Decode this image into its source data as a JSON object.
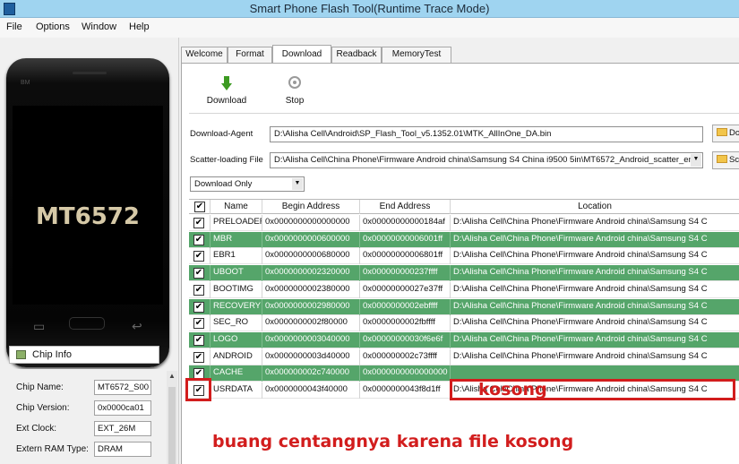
{
  "window": {
    "title": "Smart Phone Flash Tool(Runtime Trace Mode)"
  },
  "menu": [
    "File",
    "Options",
    "Window",
    "Help"
  ],
  "phone": {
    "brand": "BM",
    "model": "MT6572"
  },
  "chip_info": {
    "tab_label": "Chip Info",
    "rows": [
      {
        "key": "Chip Name:",
        "value": "MT6572_S00"
      },
      {
        "key": "Chip Version:",
        "value": "0x0000ca01"
      },
      {
        "key": "Ext Clock:",
        "value": "EXT_26M"
      },
      {
        "key": "Extern RAM Type:",
        "value": "DRAM"
      }
    ]
  },
  "tabs": [
    {
      "label": "Welcome",
      "active": false
    },
    {
      "label": "Format",
      "active": false
    },
    {
      "label": "Download",
      "active": true
    },
    {
      "label": "Readback",
      "active": false
    },
    {
      "label": "MemoryTest",
      "active": false
    }
  ],
  "toolbar": {
    "download_label": "Download",
    "stop_label": "Stop"
  },
  "download_agent": {
    "label": "Download-Agent",
    "value": "D:\\Alisha Cell\\Android\\SP_Flash_Tool_v5.1352.01\\MTK_AllInOne_DA.bin",
    "button": "Do"
  },
  "scatter": {
    "label": "Scatter-loading File",
    "value": "D:\\Alisha Cell\\China Phone\\Firmware Android china\\Samsung S4 China i9500 5in\\MT6572_Android_scatter_em",
    "button": "Sc"
  },
  "mode": {
    "value": "Download Only"
  },
  "table": {
    "headers": [
      "",
      "Name",
      "Begin Address",
      "End Address",
      "Location"
    ],
    "rows": [
      {
        "checked": true,
        "name": "PRELOADER",
        "begin": "0x0000000000000000",
        "end": "0x00000000000184af",
        "location": "D:\\Alisha Cell\\China Phone\\Firmware Android china\\Samsung S4 C",
        "highlight": false
      },
      {
        "checked": true,
        "name": "MBR",
        "begin": "0x0000000000600000",
        "end": "0x00000000006001ff",
        "location": "D:\\Alisha Cell\\China Phone\\Firmware Android china\\Samsung S4 C",
        "highlight": true
      },
      {
        "checked": true,
        "name": "EBR1",
        "begin": "0x0000000000680000",
        "end": "0x00000000006801ff",
        "location": "D:\\Alisha Cell\\China Phone\\Firmware Android china\\Samsung S4 C",
        "highlight": false
      },
      {
        "checked": true,
        "name": "UBOOT",
        "begin": "0x0000000002320000",
        "end": "0x000000000237ffff",
        "location": "D:\\Alisha Cell\\China Phone\\Firmware Android china\\Samsung S4 C",
        "highlight": true
      },
      {
        "checked": true,
        "name": "BOOTIMG",
        "begin": "0x0000000002380000",
        "end": "0x00000000027e37ff",
        "location": "D:\\Alisha Cell\\China Phone\\Firmware Android china\\Samsung S4 C",
        "highlight": false
      },
      {
        "checked": true,
        "name": "RECOVERY",
        "begin": "0x0000000002980000",
        "end": "0x0000000002ebffff",
        "location": "D:\\Alisha Cell\\China Phone\\Firmware Android china\\Samsung S4 C",
        "highlight": true
      },
      {
        "checked": true,
        "name": "SEC_RO",
        "begin": "0x0000000002f80000",
        "end": "0x0000000002fbffff",
        "location": "D:\\Alisha Cell\\China Phone\\Firmware Android china\\Samsung S4 C",
        "highlight": false
      },
      {
        "checked": true,
        "name": "LOGO",
        "begin": "0x0000000003040000",
        "end": "0x00000000030f6e6f",
        "location": "D:\\Alisha Cell\\China Phone\\Firmware Android china\\Samsung S4 C",
        "highlight": true
      },
      {
        "checked": true,
        "name": "ANDROID",
        "begin": "0x0000000003d40000",
        "end": "0x000000002c73ffff",
        "location": "D:\\Alisha Cell\\China Phone\\Firmware Android china\\Samsung S4 C",
        "highlight": false
      },
      {
        "checked": true,
        "name": "CACHE",
        "begin": "0x000000002c740000",
        "end": "0x0000000000000000",
        "location": "",
        "highlight": true
      },
      {
        "checked": true,
        "name": "USRDATA",
        "begin": "0x0000000043f40000",
        "end": "0x0000000043f8d1ff",
        "location": "D:\\Alisha Cell\\China Phone\\Firmware Android china\\Samsung S4 C",
        "highlight": false
      }
    ]
  },
  "annotations": {
    "kosong": "kosong",
    "note": "buang centangnya karena file kosong",
    "color": "#d21d1d"
  },
  "colors": {
    "row_green": "#55a56a",
    "title_bar": "#9fd4f0"
  }
}
